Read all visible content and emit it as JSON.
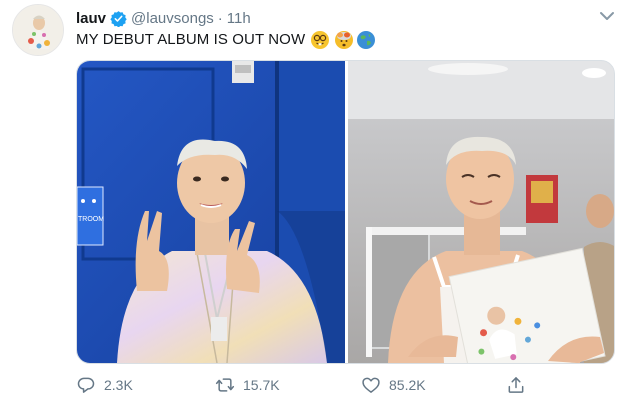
{
  "tweet": {
    "name": "lauv",
    "handle": "@lauvsongs",
    "separator": "·",
    "time": "11h",
    "text": "MY DEBUT ALBUM IS OUT NOW",
    "emojis": [
      "nerd-face-emoji",
      "exploding-head-emoji",
      "globe-emoji"
    ],
    "sign_text": "TROOM"
  },
  "actions": {
    "replies": "2.3K",
    "retweets": "15.7K",
    "likes": "85.2K"
  },
  "colors": {
    "verified": "#1da1f2",
    "muted": "#657786",
    "text": "#14171a",
    "door_blue": "#1e4fb8"
  },
  "icons": {
    "verified": "verified-badge-icon",
    "caret": "chevron-down-icon",
    "reply": "reply-icon",
    "retweet": "retweet-icon",
    "like": "heart-icon",
    "share": "share-icon"
  }
}
